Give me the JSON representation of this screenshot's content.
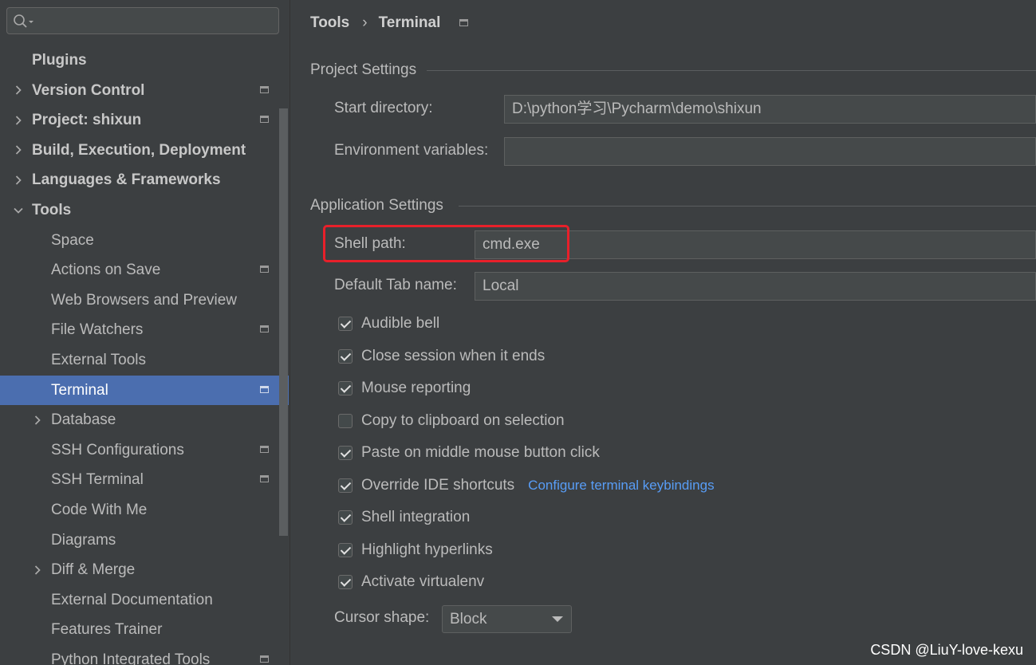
{
  "sidebar": {
    "search": {
      "placeholder": ""
    },
    "items": [
      {
        "label": "Plugins",
        "level": 0,
        "bold": true,
        "chevron": "none",
        "project_icon": false
      },
      {
        "label": "Version Control",
        "level": 0,
        "bold": true,
        "chevron": "right",
        "project_icon": true
      },
      {
        "label": "Project: shixun",
        "level": 0,
        "bold": true,
        "chevron": "right",
        "project_icon": true
      },
      {
        "label": "Build, Execution, Deployment",
        "level": 0,
        "bold": true,
        "chevron": "right",
        "project_icon": false
      },
      {
        "label": "Languages & Frameworks",
        "level": 0,
        "bold": true,
        "chevron": "right",
        "project_icon": false
      },
      {
        "label": "Tools",
        "level": 0,
        "bold": true,
        "chevron": "down",
        "project_icon": false
      },
      {
        "label": "Space",
        "level": 1,
        "bold": false,
        "chevron": "none",
        "project_icon": false
      },
      {
        "label": "Actions on Save",
        "level": 1,
        "bold": false,
        "chevron": "none",
        "project_icon": true
      },
      {
        "label": "Web Browsers and Preview",
        "level": 1,
        "bold": false,
        "chevron": "none",
        "project_icon": false
      },
      {
        "label": "File Watchers",
        "level": 1,
        "bold": false,
        "chevron": "none",
        "project_icon": true
      },
      {
        "label": "External Tools",
        "level": 1,
        "bold": false,
        "chevron": "none",
        "project_icon": false
      },
      {
        "label": "Terminal",
        "level": 1,
        "bold": false,
        "chevron": "none",
        "project_icon": true,
        "selected": true
      },
      {
        "label": "Database",
        "level": 1,
        "bold": false,
        "chevron": "right",
        "project_icon": false
      },
      {
        "label": "SSH Configurations",
        "level": 1,
        "bold": false,
        "chevron": "none",
        "project_icon": true
      },
      {
        "label": "SSH Terminal",
        "level": 1,
        "bold": false,
        "chevron": "none",
        "project_icon": true
      },
      {
        "label": "Code With Me",
        "level": 1,
        "bold": false,
        "chevron": "none",
        "project_icon": false
      },
      {
        "label": "Diagrams",
        "level": 1,
        "bold": false,
        "chevron": "none",
        "project_icon": false
      },
      {
        "label": "Diff & Merge",
        "level": 1,
        "bold": false,
        "chevron": "right",
        "project_icon": false
      },
      {
        "label": "External Documentation",
        "level": 1,
        "bold": false,
        "chevron": "none",
        "project_icon": false
      },
      {
        "label": "Features Trainer",
        "level": 1,
        "bold": false,
        "chevron": "none",
        "project_icon": false
      },
      {
        "label": "Python Integrated Tools",
        "level": 1,
        "bold": false,
        "chevron": "none",
        "project_icon": true
      }
    ]
  },
  "breadcrumb": {
    "parent": "Tools",
    "separator": "›",
    "current": "Terminal"
  },
  "project_settings": {
    "title": "Project Settings",
    "start_directory_label": "Start directory:",
    "start_directory_value": "D:\\python学习\\Pycharm\\demo\\shixun",
    "env_vars_label": "Environment variables:",
    "env_vars_value": ""
  },
  "application_settings": {
    "title": "Application Settings",
    "shell_path_label": "Shell path:",
    "shell_path_value": "cmd.exe",
    "default_tab_label": "Default Tab name:",
    "default_tab_value": "Local",
    "checkboxes": [
      {
        "label": "Audible bell",
        "checked": true
      },
      {
        "label": "Close session when it ends",
        "checked": true
      },
      {
        "label": "Mouse reporting",
        "checked": true
      },
      {
        "label": "Copy to clipboard on selection",
        "checked": false
      },
      {
        "label": "Paste on middle mouse button click",
        "checked": true
      },
      {
        "label": "Override IDE shortcuts",
        "checked": true,
        "link": "Configure terminal keybindings"
      },
      {
        "label": "Shell integration",
        "checked": true
      },
      {
        "label": "Highlight hyperlinks",
        "checked": true
      },
      {
        "label": "Activate virtualenv",
        "checked": true
      }
    ],
    "cursor_shape_label": "Cursor shape:",
    "cursor_shape_value": "Block"
  },
  "watermark": "CSDN @LiuY-love-kexu",
  "colors": {
    "background": "#3c3f41",
    "selection": "#4b6eaf",
    "link": "#589df6",
    "highlight_box": "#e8202a"
  }
}
